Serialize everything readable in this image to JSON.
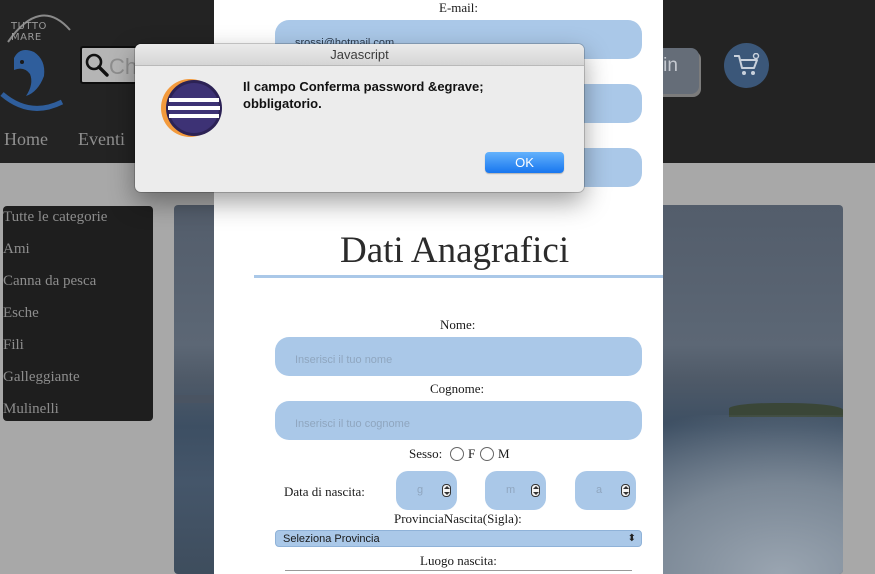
{
  "header": {
    "logo_text": "TUTTO MARE",
    "search_placeholder": "Ch",
    "login_label": "ogin",
    "nav": {
      "home": "Home",
      "eventi": "Eventi"
    }
  },
  "categories": [
    "Tutte le categorie",
    "Ami",
    "Canna da pesca",
    "Esche",
    "Fili",
    "Galleggiante",
    "Mulinelli"
  ],
  "form": {
    "email_label": "E-mail:",
    "email_value": "srossi@hotmail.com",
    "section_title": "Dati Anagrafici",
    "nome_label": "Nome:",
    "nome_placeholder": "Inserisci il tuo nome",
    "cognome_label": "Cognome:",
    "cognome_placeholder": "Inserisci il tuo cognome",
    "sesso_label": "Sesso:",
    "sesso_f": "F",
    "sesso_m": "M",
    "nascita_label": "Data di nascita:",
    "giorno_placeholder": "g",
    "mese_placeholder": "m",
    "anno_placeholder": "a",
    "provincia_label": "ProvinciaNascita(Sigla):",
    "provincia_selected": "Seleziona Provincia",
    "luogo_label": "Luogo nascita:"
  },
  "dialog": {
    "title": "Javascript",
    "message": "Il campo Conferma password &egrave; obbligatorio.",
    "ok_label": "OK"
  },
  "colors": {
    "field_blue": "#aac8e8",
    "ok_button": "#1776ef",
    "header_bg": "#232323"
  }
}
